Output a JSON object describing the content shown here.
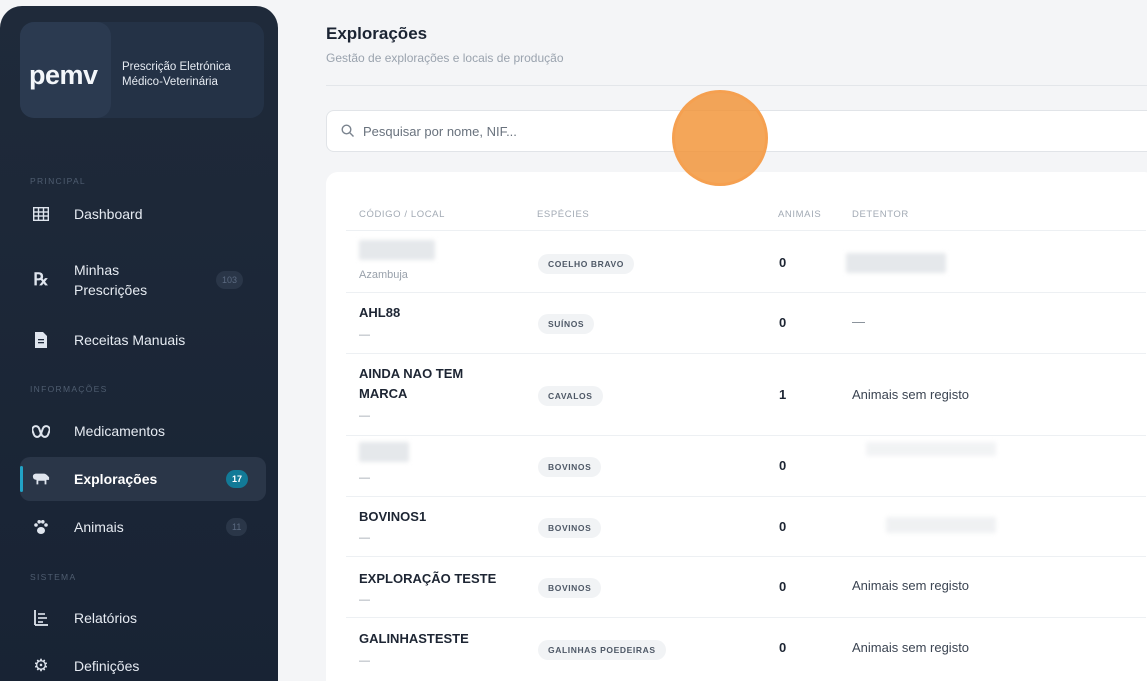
{
  "brand": {
    "logo": "pemv",
    "title_line1": "Prescrição Eletrónica",
    "title_line2": "Médico-Veterinária"
  },
  "sidebar": {
    "sections": {
      "principal": "PRINCIPAL",
      "informacoes": "INFORMAÇÕES",
      "sistema": "SISTEMA"
    },
    "items": [
      {
        "label": "Dashboard",
        "icon": "grid-icon"
      },
      {
        "label": "Minhas Prescrições",
        "icon": "rx-icon",
        "badge": "103"
      },
      {
        "label": "Receitas Manuais",
        "icon": "document-icon"
      },
      {
        "label": "Medicamentos",
        "icon": "pills-icon"
      },
      {
        "label": "Explorações",
        "icon": "farm-animal-icon",
        "badge": "17",
        "active": true
      },
      {
        "label": "Animais",
        "icon": "paw-icon",
        "badge": "11"
      },
      {
        "label": "Relatórios",
        "icon": "report-icon"
      },
      {
        "label": "Definições",
        "icon": "gear-icon"
      }
    ]
  },
  "header": {
    "title": "Explorações",
    "subtitle": "Gestão de explorações e locais de produção"
  },
  "search": {
    "placeholder": "Pesquisar por nome, NIF..."
  },
  "table": {
    "columns": [
      "CÓDIGO / LOCAL",
      "ESPÉCIES",
      "ANIMAIS",
      "DETENTOR"
    ],
    "rows": [
      {
        "code": "",
        "location": "Azambuja",
        "species": "COELHO BRAVO",
        "animals": "0",
        "holder": ""
      },
      {
        "code": "AHL88",
        "location": "—",
        "species": "SUÍNOS",
        "animals": "0",
        "holder": "—"
      },
      {
        "code": "AINDA NAO TEM MARCA",
        "location": "—",
        "species": "CAVALOS",
        "animals": "1",
        "holder": "Animais sem registo"
      },
      {
        "code": "",
        "location": "—",
        "species": "BOVINOS",
        "animals": "0",
        "holder": ""
      },
      {
        "code": "BOVINOS1",
        "location": "—",
        "species": "BOVINOS",
        "animals": "0",
        "holder": ""
      },
      {
        "code": "EXPLORAÇÃO TESTE",
        "location": "—",
        "species": "BOVINOS",
        "animals": "0",
        "holder": "Animais sem registo"
      },
      {
        "code": "GALINHASTESTE",
        "location": "—",
        "species": "GALINHAS POEDEIRAS",
        "animals": "0",
        "holder": "Animais sem registo"
      }
    ]
  },
  "colors": {
    "sidebar_bg": "#1f2a3a",
    "accent": "#127a97",
    "cursor": "#f19234"
  }
}
